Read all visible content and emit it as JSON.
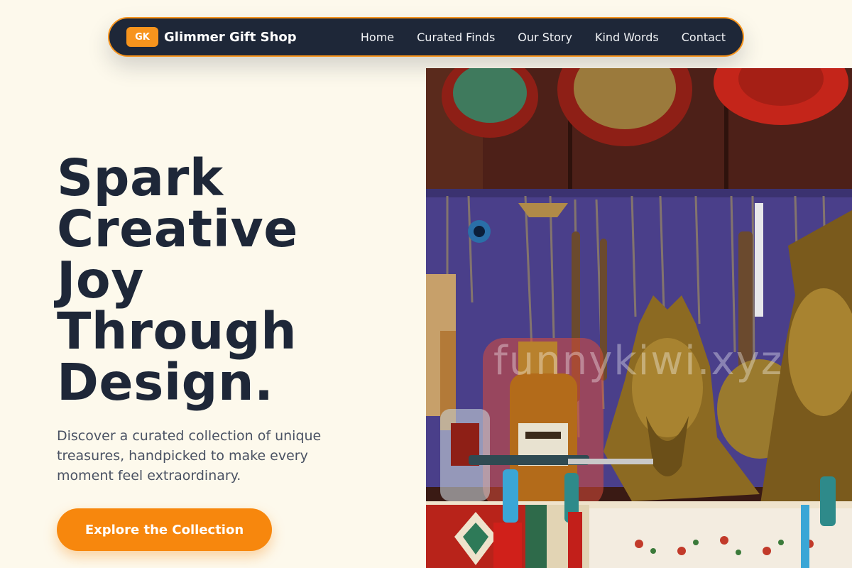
{
  "nav": {
    "logo_badge": "GK",
    "brand": "Glimmer Gift Shop",
    "links": [
      "Home",
      "Curated Finds",
      "Our Story",
      "Kind Words",
      "Contact"
    ]
  },
  "hero": {
    "title_lines": [
      "Spark",
      "Creative",
      "Joy",
      "Through",
      "Design."
    ],
    "subtitle": "Discover a curated collection of unique treasures, handpicked to make every moment feel extraordinary.",
    "cta_label": "Explore the Collection",
    "image_watermark": "funnykiwi.xyz"
  },
  "colors": {
    "background": "#fdf9ec",
    "nav_bg": "#1e2738",
    "accent": "#f7941d",
    "heading": "#1e2738",
    "body_text": "#4a5263"
  }
}
